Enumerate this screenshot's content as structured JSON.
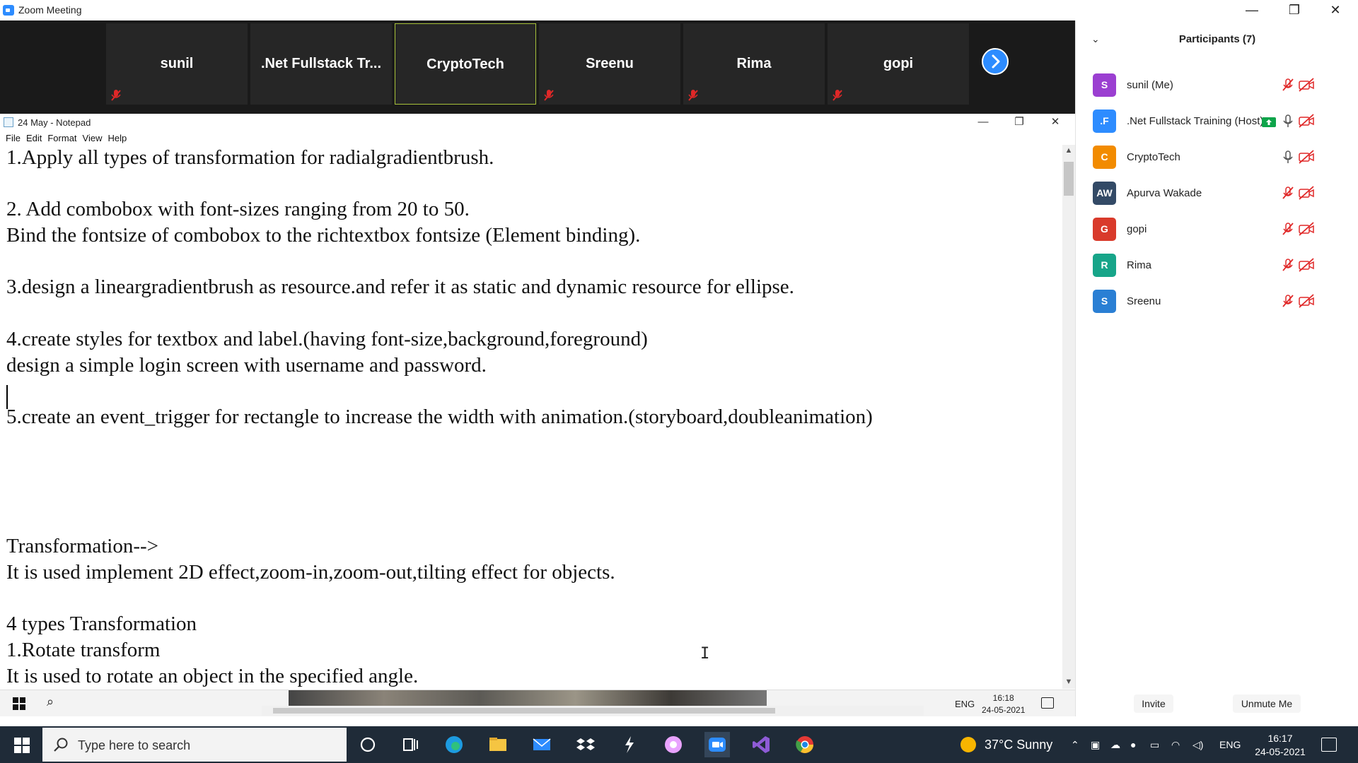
{
  "zoom_window": {
    "title": "Zoom Meeting",
    "controls": {
      "minimize": "—",
      "restore": "❐",
      "close": "✕"
    }
  },
  "video_strip": {
    "tiles": [
      {
        "name": "sunil",
        "muted": true,
        "active": false
      },
      {
        "name": ".Net Fullstack Tr...",
        "muted": false,
        "active": false
      },
      {
        "name": "CryptoTech",
        "muted": false,
        "active": true
      },
      {
        "name": "Sreenu",
        "muted": true,
        "active": false
      },
      {
        "name": "Rima",
        "muted": true,
        "active": false
      },
      {
        "name": "gopi",
        "muted": true,
        "active": false
      }
    ],
    "next_icon": "chevron-right-icon"
  },
  "notepad": {
    "title": "24 May - Notepad",
    "controls": {
      "minimize": "—",
      "restore": "❐",
      "close": "✕"
    },
    "menu": [
      "File",
      "Edit",
      "Format",
      "View",
      "Help"
    ],
    "lines": [
      "1.Apply all types of transformation for radialgradientbrush.",
      "",
      "2. Add combobox with font-sizes ranging from 20 to 50.",
      "Bind the fontsize of combobox to the richtextbox fontsize (Element binding).",
      "",
      "3.design a lineargradientbrush as resource.and refer it as static and dynamic resource for ellipse.",
      "",
      "4.create styles for textbox and label.(having font-size,background,foreground)",
      "design a simple login screen with username and password.",
      "",
      "5.create an event_trigger for rectangle to increase the width with animation.(storyboard,doubleanimation)",
      "",
      "",
      "",
      "",
      "Transformation-->",
      "It is used implement 2D effect,zoom-in,zoom-out,tilting effect for objects.",
      "",
      "4 types Transformation",
      "1.Rotate transform",
      "It is used to rotate an object in the specified angle."
    ],
    "cursor_glyph": "I"
  },
  "shared_taskbar": {
    "lang": "ENG",
    "time": "16:18",
    "date": "24-05-2021"
  },
  "participants_panel": {
    "title": "Participants (7)",
    "people": [
      {
        "initials": "S",
        "name": "sunil (Me)",
        "color": "#9b3fd1",
        "mic_muted": true,
        "video_off": true,
        "screen_share": false
      },
      {
        "initials": ".F",
        "name": ".Net Fullstack Training (Host)",
        "color": "#2d8cff",
        "mic_muted": false,
        "video_off": true,
        "screen_share": true
      },
      {
        "initials": "C",
        "name": "CryptoTech",
        "color": "#f28b00",
        "mic_muted": false,
        "video_off": true,
        "screen_share": false
      },
      {
        "initials": "AW",
        "name": "Apurva Wakade",
        "color": "#334a66",
        "mic_muted": true,
        "video_off": true,
        "screen_share": false
      },
      {
        "initials": "G",
        "name": "gopi",
        "color": "#d93a2b",
        "mic_muted": true,
        "video_off": true,
        "screen_share": false
      },
      {
        "initials": "R",
        "name": "Rima",
        "color": "#17a589",
        "mic_muted": true,
        "video_off": true,
        "screen_share": false
      },
      {
        "initials": "S",
        "name": "Sreenu",
        "color": "#2a7fd4",
        "mic_muted": true,
        "video_off": true,
        "screen_share": false
      }
    ],
    "invite_label": "Invite",
    "unmute_label": "Unmute Me"
  },
  "windows_taskbar": {
    "search_placeholder": "Type here to search",
    "weather": "37°C  Sunny",
    "lang": "ENG",
    "time": "16:17",
    "date": "24-05-2021",
    "apps": [
      "cortana-icon",
      "task-view-icon",
      "edge-icon",
      "file-explorer-icon",
      "mail-icon",
      "dropbox-icon",
      "app-icon",
      "chrome-canary-icon",
      "zoom-icon",
      "visual-studio-icon",
      "chrome-icon"
    ]
  },
  "colors": {
    "zoom_blue": "#2d8cff",
    "mute_red": "#e02828",
    "active_border": "#a8c23a",
    "taskbar_bg": "#1f2b38"
  }
}
